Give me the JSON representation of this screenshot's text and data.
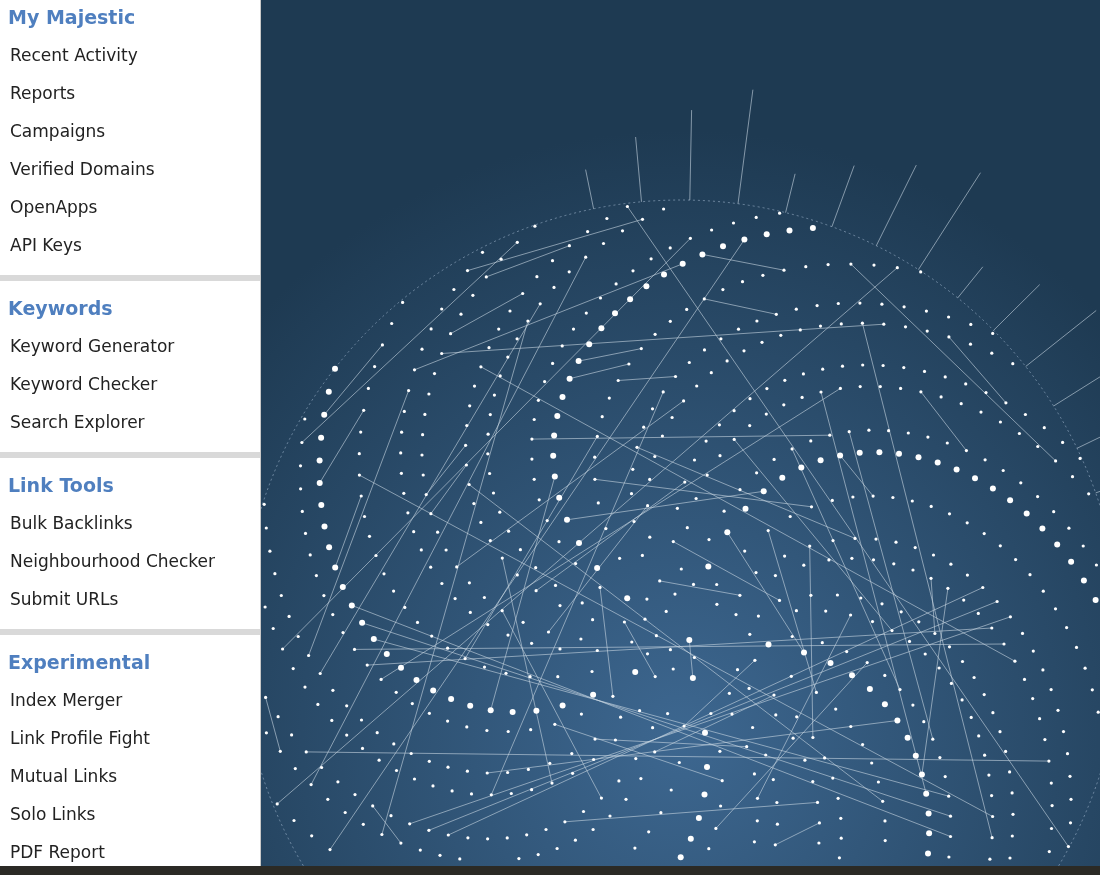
{
  "sidebar": {
    "sections": [
      {
        "title": "My Majestic",
        "items": [
          "Recent Activity",
          "Reports",
          "Campaigns",
          "Verified Domains",
          "OpenApps",
          "API Keys"
        ]
      },
      {
        "title": "Keywords",
        "items": [
          "Keyword Generator",
          "Keyword Checker",
          "Search Explorer"
        ]
      },
      {
        "title": "Link Tools",
        "items": [
          "Bulk Backlinks",
          "Neighbourhood Checker",
          "Submit URLs"
        ]
      },
      {
        "title": "Experimental",
        "items": [
          "Index Merger",
          "Link Profile Fight",
          "Mutual Links",
          "Solo Links",
          "PDF Report"
        ]
      }
    ]
  }
}
